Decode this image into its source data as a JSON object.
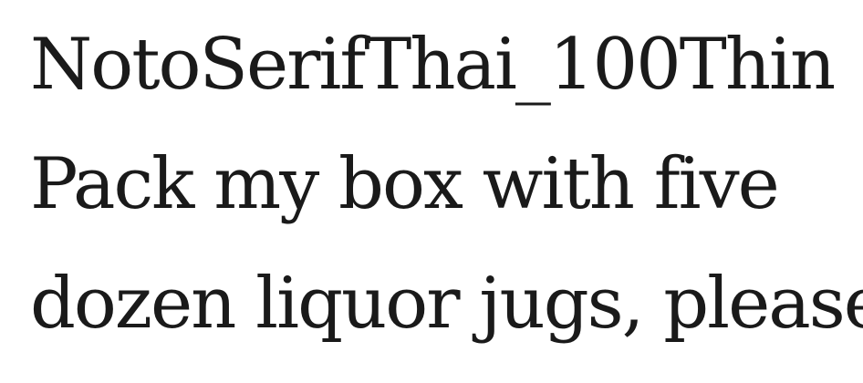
{
  "font_sample": {
    "title": "NotoSerifThai_100Thin",
    "lines": [
      "Pack my box with five",
      "dozen liquor jugs, please."
    ]
  }
}
